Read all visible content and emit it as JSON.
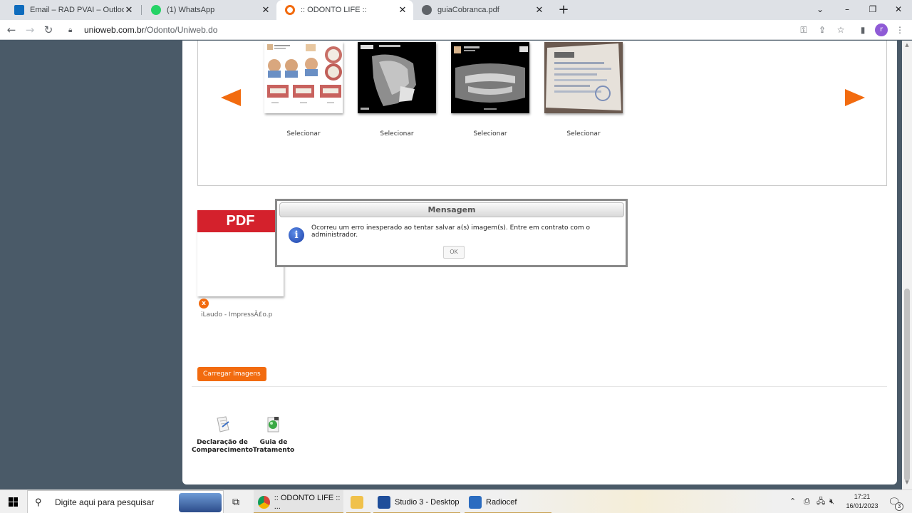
{
  "browser": {
    "tabs": [
      {
        "label": "Email – RAD PVAI – Outlook",
        "icon": "outlook-icon",
        "color": "#0f6cbd"
      },
      {
        "label": "(1) WhatsApp",
        "icon": "whatsapp-icon",
        "color": "#25d366"
      },
      {
        "label": ":: ODONTO LIFE ::",
        "icon": "odonto-life-icon",
        "color": "#f26b0f"
      },
      {
        "label": "guiaCobranca.pdf",
        "icon": "globe-icon",
        "color": "#5f6368"
      }
    ],
    "new_tab": "+",
    "url_host": "unioweb.com.br",
    "url_path": "/Odonto/Uniweb.do",
    "profile_initial": "r"
  },
  "gallery": {
    "select_label": "Selecionar",
    "items": [
      {
        "name": "photo-collage-thumbnail"
      },
      {
        "name": "cephalometric-xray-thumbnail"
      },
      {
        "name": "panoramic-xray-thumbnail"
      },
      {
        "name": "scanned-document-thumbnail"
      }
    ]
  },
  "attachment": {
    "badge": "PDF",
    "remove": "x",
    "filename": "iLaudo - ImpressÃ£o.p"
  },
  "load_button": "Carregar Imagens",
  "shortcuts": [
    {
      "label": "Declaração de Comparecimento",
      "icon": "certificate-document-icon"
    },
    {
      "label": "Guia de Tratamento",
      "icon": "treatment-guide-icon"
    }
  ],
  "dialog": {
    "title": "Mensagem",
    "icon": "info-icon",
    "message": "Ocorreu um erro inesperado ao tentar salvar a(s) imagem(s). Entre em contrato com o administrador.",
    "ok": "OK"
  },
  "taskbar": {
    "search_placeholder": "Digite aqui para pesquisar",
    "apps": [
      {
        "label": ":: ODONTO LIFE :: ...",
        "icon": "chrome-icon"
      },
      {
        "label": "",
        "icon": "file-explorer-icon"
      },
      {
        "label": "Studio 3 - Desktop",
        "icon": "studio-icon"
      },
      {
        "label": "Radiocef",
        "icon": "radiocef-icon"
      }
    ],
    "time": "17:21",
    "date": "16/01/2023",
    "notification_count": "3"
  },
  "colors": {
    "accent": "#f26b0f",
    "pdf_red": "#d4212c",
    "page_bg": "#4a5a68"
  }
}
